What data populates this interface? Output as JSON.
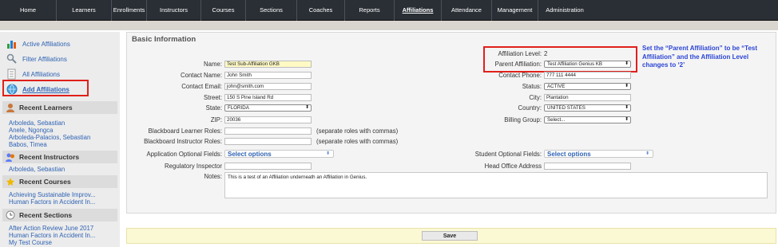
{
  "nav": {
    "items": [
      "Home",
      "Learners",
      "Enrollments",
      "Instructors",
      "Courses",
      "Sections",
      "Coaches",
      "Reports",
      "Affiliations",
      "Attendance",
      "Management",
      "Administration"
    ],
    "active": "Affiliations"
  },
  "sidebar": {
    "links": [
      {
        "label": "Active Affiliations",
        "icon": "chart-bar-icon"
      },
      {
        "label": "Filter Affiliations",
        "icon": "filter-icon"
      },
      {
        "label": "All Affiliations",
        "icon": "document-list-icon"
      },
      {
        "label": "Add Affiliations",
        "icon": "globe-add-icon"
      }
    ],
    "recent_learners": {
      "title": "Recent Learners",
      "items": [
        "Arboleda, Sebastian",
        "Anele, Ngongca",
        "Arboleda-Palacios, Sebastian",
        "Babos, Timea"
      ]
    },
    "recent_instructors": {
      "title": "Recent Instructors",
      "items": [
        "Arboleda, Sebastian"
      ]
    },
    "recent_courses": {
      "title": "Recent Courses",
      "items": [
        "Achieving Sustainable Improv...",
        "Human Factors in Accident In..."
      ]
    },
    "recent_sections": {
      "title": "Recent Sections",
      "items": [
        "After Action Review June 2017",
        "Human Factors in Accident In...",
        "My Test Course"
      ]
    }
  },
  "form": {
    "title": "Basic Information",
    "name_label": "Name:",
    "name_value": "Test Sub-Affiliation GKB",
    "contact_name_label": "Contact Name:",
    "contact_name_value": "John Smith",
    "contact_email_label": "Contact Email:",
    "contact_email_value": "john@smith.com",
    "street_label": "Street:",
    "street_value": "150 S Pine Island Rd",
    "state_label": "State:",
    "state_value": "FLORIDA",
    "zip_label": "ZIP:",
    "zip_value": "20036",
    "bb_learner_roles_label": "Blackboard Learner Roles:",
    "bb_learner_roles_value": "",
    "bb_instructor_roles_label": "Blackboard Instructor Roles:",
    "bb_instructor_roles_value": "",
    "roles_hint": "(separate roles with commas)",
    "app_optional_label": "Application Optional Fields:",
    "app_optional_value": "Select options",
    "reg_inspector_label": "Regulatory Inspector",
    "reg_inspector_value": "",
    "notes_label": "Notes:",
    "notes_value": "This is a test of an Affiliation underneath an Affiliation in Genius.",
    "affiliation_level_label": "Affiliation Level:",
    "affiliation_level_value": "2",
    "parent_affiliation_label": "Parent Affiliation:",
    "parent_affiliation_value": "Test Affiliation Genius KB",
    "contact_phone_label": "Contact Phone:",
    "contact_phone_value": "777 111 4444",
    "status_label": "Status:",
    "status_value": "ACTIVE",
    "city_label": "City:",
    "city_value": "Plantation",
    "country_label": "Country:",
    "country_value": "UNITED STATES",
    "billing_group_label": "Billing Group:",
    "billing_group_value": "Select...",
    "student_optional_label": "Student Optional Fields:",
    "student_optional_value": "Select options",
    "head_office_label": "Head Office Address",
    "head_office_value": ""
  },
  "annotation": "Set the “Parent Affiliation” to be “Test Affiliation” and the Affiliation Level changes to ‘2’",
  "footer": {
    "save_label": "Save"
  },
  "colors": {
    "accent_red": "#e0201b",
    "annotation_blue": "#2c45d4",
    "link_blue": "#2f63b3",
    "nav_bg": "#2a2f35"
  }
}
